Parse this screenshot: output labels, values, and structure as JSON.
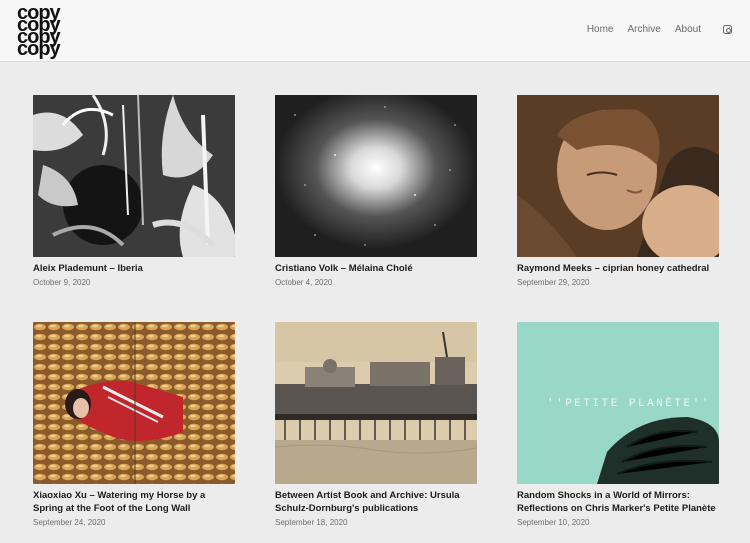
{
  "site": {
    "logo_text": "copy"
  },
  "nav": {
    "items": [
      "Home",
      "Archive",
      "About"
    ],
    "instagram_icon": "instagram-icon"
  },
  "posts": [
    {
      "title": "Aleix Plademunt – Iberia",
      "date": "October 9, 2020",
      "image": "black-and-white jungle foliage"
    },
    {
      "title": "Cristiano Volk – Mélaina Cholé",
      "date": "October 4, 2020",
      "image": "starburst on dark ground"
    },
    {
      "title": "Raymond Meeks – ciprian honey cathedral",
      "date": "September 29, 2020",
      "image": "portrait of a woman"
    },
    {
      "title": "Xiaoxiao Xu – Watering my Horse by a Spring at the Foot of the Long Wall",
      "date": "September 24, 2020",
      "image": "figure lying in corn cobs"
    },
    {
      "title": "Between Artist Book and Archive: Ursula Schulz-Dornburg's publications",
      "date": "September 18, 2020",
      "image": "pier over the sea"
    },
    {
      "title": "Random Shocks in a World of Mirrors: Reflections on Chris Marker's Petite Planète",
      "date": "September 10, 2020",
      "image": "mint cover with petite planete text",
      "image_text": "''PETITE PLANÈTE''"
    }
  ]
}
